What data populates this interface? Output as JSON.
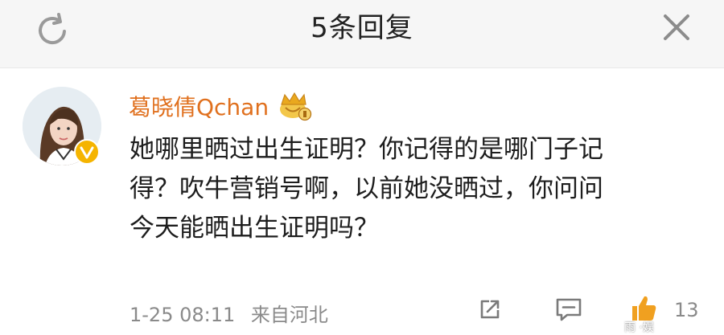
{
  "header": {
    "title": "5条回复"
  },
  "comment": {
    "username": "葛晓倩Qchan",
    "content_lines": [
      "她哪里晒过出生证明？你记得的是哪门子记",
      "得？吹牛营销号啊，以前她没晒过，你问问",
      "今天能晒出生证明吗？"
    ],
    "date": "1-25 08:11",
    "source": "来自河北",
    "like_count": "13"
  },
  "watermark": {
    "text": "雨 ·娱"
  },
  "icons": {
    "refresh": "refresh-icon",
    "close": "close-icon",
    "verified": "verified-badge-icon",
    "crown": "crown-badge-icon",
    "repost": "repost-icon",
    "reply": "reply-icon",
    "like": "like-icon"
  },
  "colors": {
    "username": "#e0701e",
    "verified_badge": "#f5b400",
    "like_icon": "#f0a020",
    "meta_text": "#8a8a8a"
  }
}
